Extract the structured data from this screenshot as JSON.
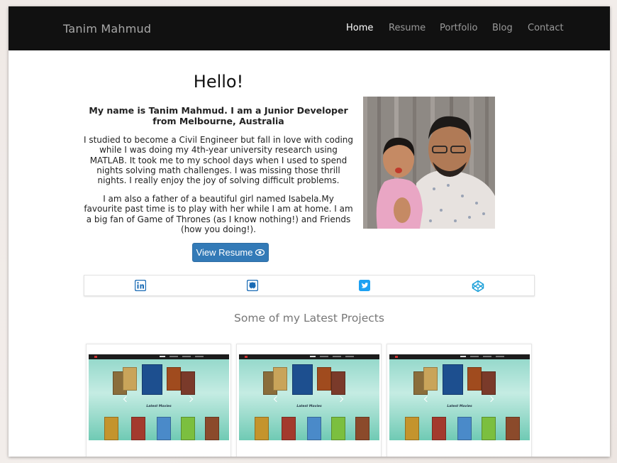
{
  "header": {
    "brand": "Tanim Mahmud",
    "nav": [
      {
        "label": "Home",
        "active": true
      },
      {
        "label": "Resume",
        "active": false
      },
      {
        "label": "Portfolio",
        "active": false
      },
      {
        "label": "Blog",
        "active": false
      },
      {
        "label": "Contact",
        "active": false
      }
    ]
  },
  "intro": {
    "greeting": "Hello!",
    "tagline": "My name is Tanim Mahmud. I am a Junior Developer from Melbourne, Australia",
    "paragraph1": "I studied to become a Civil Engineer but fall in love with coding while I was doing my 4th-year university research using MATLAB. It took me to my school days when I used to spend nights solving math challenges. I was missing those thrill nights. I really enjoy the joy of solving difficult problems.",
    "paragraph2": "I am also a father of a beautiful girl named Isabela.My favourite past time is to play with her while I am at home. I am a big fan of Game of Thrones (as I know nothing!) and Friends (how you doing!).",
    "resume_button": "View Resume",
    "resume_icon": "eye-icon",
    "photo": "profile-photo"
  },
  "social": [
    {
      "icon": "linkedin-icon",
      "color": "#1a6bb5"
    },
    {
      "icon": "github-icon",
      "color": "#1a6bb5"
    },
    {
      "icon": "twitter-icon",
      "color": "#1da1f2"
    },
    {
      "icon": "codepen-icon",
      "color": "#1a9fd8"
    }
  ],
  "projects": {
    "heading": "Some of my Latest Projects",
    "cards": [
      {
        "thumbnail": "movie-site-screenshot",
        "caption": "Latest Movies"
      },
      {
        "thumbnail": "movie-site-screenshot",
        "caption": "Latest Movies"
      },
      {
        "thumbnail": "movie-site-screenshot",
        "caption": "Latest Movies"
      }
    ]
  },
  "colors": {
    "navbar": "#111111",
    "button": "#337ab7",
    "accent": "#1a6bb5"
  }
}
